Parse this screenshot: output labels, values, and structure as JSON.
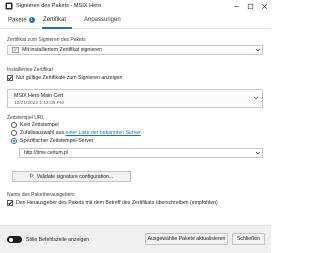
{
  "window": {
    "title": "Signieren des Pakets - MSIX Hero",
    "accent": "#1a6fc2"
  },
  "tabs": [
    {
      "label": "Pakete",
      "badge": "1",
      "active": false
    },
    {
      "label": "Zertifikat",
      "active": true
    },
    {
      "label": "Anpassungen",
      "active": false
    }
  ],
  "signing": {
    "section_label": "Zertifikat zum Signieren des Pakets",
    "mode_value": "Mit installiertem Zertifikat signieren"
  },
  "installed": {
    "section_label": "Installiertes Zertifikat",
    "only_valid_label": "Nur gültige Zertifikate zum Signieren anzeigen",
    "only_valid_checked": true,
    "cert_name": "MSIX Hero Main Cert",
    "cert_date": "12/21/2022 1:12:06 PM"
  },
  "timestamp": {
    "section_label": "Zeitstempel URL",
    "option_none": "Kein Zeitstempel",
    "option_random_prefix": "Zufallsauswahl aus",
    "option_random_link": "einer Liste der bekannten Server",
    "option_specific": "Spezifischer Zeitstempel-Server",
    "selected": "specific",
    "server_url": "http://time.certum.pl"
  },
  "validate_label": "Validate signature configuration...",
  "publisher": {
    "section_label": "Name des Paketherausgebers",
    "override_label": "Den Herausgeber des Pakets mit dem Betreff des Zertifikats überschreiben (empfohlen)",
    "override_checked": true
  },
  "footer": {
    "silent_label": "Stille Befehlszeile anzeigen",
    "silent_on": true,
    "update_label": "Ausgewählte Pakete aktualisieren",
    "close_label": "Schließen"
  }
}
